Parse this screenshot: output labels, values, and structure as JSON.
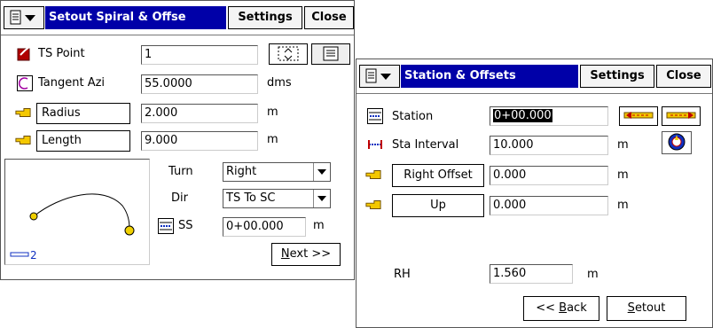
{
  "window1": {
    "title": "Setout Spiral & Offse",
    "settings_label": "Settings",
    "close_label": "Close",
    "ts_point": {
      "label": "TS Point",
      "value": "1"
    },
    "tangent_azi": {
      "label": "Tangent Azi",
      "value": "55.0000",
      "unit": "dms"
    },
    "radius": {
      "label": "Radius",
      "value": "2.000",
      "unit": "m"
    },
    "length": {
      "label": "Length",
      "value": "9.000",
      "unit": "m"
    },
    "turn": {
      "label": "Turn",
      "value": "Right"
    },
    "dir": {
      "label": "Dir",
      "value": "TS To SC"
    },
    "ss": {
      "label": "SS",
      "value": "0+00.000",
      "unit": "m"
    },
    "scale_label": "2",
    "next_label_accel": "N",
    "next_label_rest": "ext >>"
  },
  "window2": {
    "title": "Station & Offsets",
    "settings_label": "Settings",
    "close_label": "Close",
    "station": {
      "label": "Station",
      "value": "0+00.000"
    },
    "sta_interval": {
      "label": "Sta Interval",
      "value": "10.000",
      "unit": "m"
    },
    "right_offset": {
      "label": "Right Offset",
      "value": "0.000",
      "unit": "m"
    },
    "up": {
      "label": "Up",
      "value": "0.000",
      "unit": "m"
    },
    "rh": {
      "label": "RH",
      "value": "1.560",
      "unit": "m"
    },
    "back_label_prefix": "<< ",
    "back_label_accel": "B",
    "back_label_rest": "ack",
    "setout_label_accel": "S",
    "setout_label_rest": "etout"
  },
  "colors": {
    "title_bg": "#0000a8",
    "spiral_point": "#f0d000",
    "station_blue": "#1030c0",
    "interval_red": "#c00000"
  }
}
